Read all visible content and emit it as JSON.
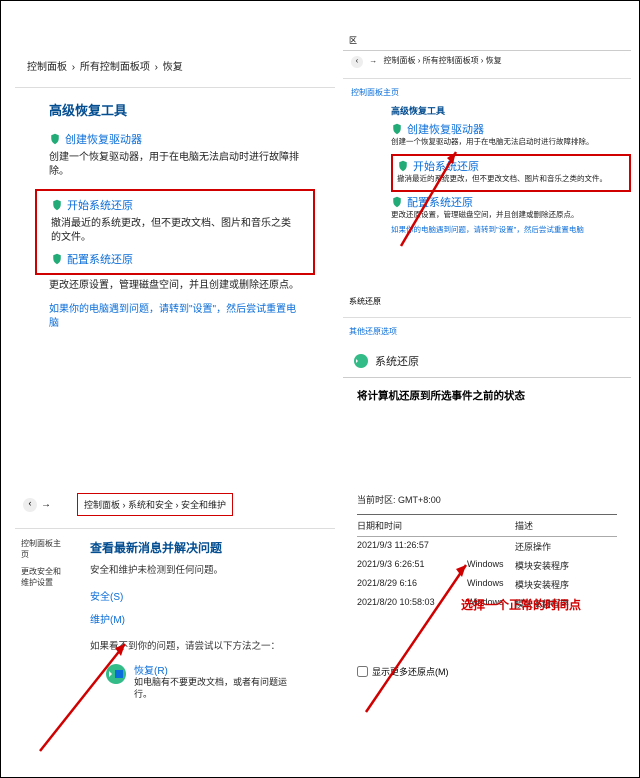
{
  "p1": {
    "breadcrumb": [
      "控制面板",
      "所有控制面板项",
      "恢复"
    ],
    "title": "高级恢复工具",
    "row1_link": "创建恢复驱动器",
    "row1_desc": "创建一个恢复驱动器，用于在电脑无法启动时进行故障排除。",
    "row2_link": "开始系统还原",
    "row2_desc": "撤消最近的系统更改，但不更改文档、图片和音乐之类的文件。",
    "row3_link": "配置系统还原",
    "row3_desc": "更改还原设置，管理磁盘空间，并且创建或删除还原点。",
    "row4_link": "如果你的电脑遇到问题，请转到\"设置\"，然后尝试重置电脑"
  },
  "p2": {
    "tag": "区",
    "breadcrumb_arrow": "→",
    "breadcrumb": "控制面板 › 所有控制面板项 › 恢复",
    "side": "控制面板主页",
    "title": "高级恢复工具",
    "row1_link": "创建恢复驱动器",
    "row1_desc": "创建一个恢复驱动器，用于在电脑无法启动时进行故障排除。",
    "row2_link": "开始系统还原",
    "row2_desc": "撤消最近的系统更改，但不更改文档、图片和音乐之类的文件。",
    "row3_link": "配置系统还原",
    "row3_desc": "更改还原设置，管理磁盘空间，并且创建或删除还原点。",
    "row4_link": "如果你的电脑遇到问题，请转到\"设置\"，然后尝试重置电脑"
  },
  "p3": {
    "breadcrumb": "控制面板 › 系统和安全 › 安全和维护",
    "side1": "控制面板主页",
    "side2": "更改安全和维护设置",
    "heading": "查看最新消息并解决问题",
    "sub": "安全和维护未检测到任何问题。",
    "sec": "安全(S)",
    "maint": "维护(M)",
    "tip": "如果看不到你的问题，请尝试以下方法之一：",
    "restore_link": "恢复(R)",
    "restore_text": "如电脑有不要更改文档，或者有问题运行。"
  },
  "p4": {
    "tag": "系统还原",
    "other": "其他还原选项",
    "title": "系统还原",
    "subtitle": "将计算机还原到所选事件之前的状态",
    "tz": "当前时区: GMT+8:00",
    "head_col1": "日期和时间",
    "head_col2": "描述",
    "head_col3": "",
    "rows": [
      {
        "c1": "2021/9/3 11:26:57",
        "c2": "",
        "c3": "还原操作"
      },
      {
        "c1": "2021/9/3 6:26:51",
        "c2": "Windows",
        "c3": "模块安装程序"
      },
      {
        "c1": "2021/8/29 6:16",
        "c2": "Windows",
        "c3": "模块安装程序"
      },
      {
        "c1": "2021/8/20 10:58:03",
        "c2": "Windows",
        "c3": "模块安装程序"
      }
    ],
    "annot": "选择一个正常的时间点",
    "chk": "显示更多还原点(M)"
  }
}
